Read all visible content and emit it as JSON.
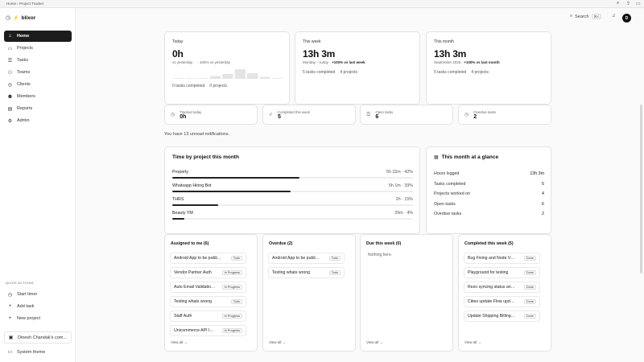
{
  "chrome": {
    "breadcrumb": "Home › Project Tracker"
  },
  "sidebar": {
    "brand": "blixor",
    "items": [
      {
        "label": "Home",
        "icon": "home-icon",
        "glyph": "⌂"
      },
      {
        "label": "Projects",
        "icon": "folder-icon",
        "glyph": "▭"
      },
      {
        "label": "Tasks",
        "icon": "checklist-icon",
        "glyph": "☰"
      },
      {
        "label": "Teams",
        "icon": "team-icon",
        "glyph": "⚇"
      },
      {
        "label": "Clients",
        "icon": "client-icon",
        "glyph": "◎"
      },
      {
        "label": "Members",
        "icon": "members-icon",
        "glyph": "⚉"
      },
      {
        "label": "Reports",
        "icon": "reports-icon",
        "glyph": "▤"
      },
      {
        "label": "Admin",
        "icon": "admin-icon",
        "glyph": "⚙"
      }
    ],
    "quick_actions_title": "QUICK ACTIONS",
    "quick_actions": [
      {
        "label": "Start timer",
        "glyph": "◷"
      },
      {
        "label": "Add task",
        "glyph": "+"
      },
      {
        "label": "New project",
        "glyph": "+"
      }
    ],
    "workspace": "Dinesh Chandak's com…",
    "theme": "System theme"
  },
  "topbar": {
    "search_label": "Search",
    "shortcut": "⌘K",
    "avatar_initial": "D"
  },
  "summary": {
    "today": {
      "kicker": "Today",
      "value": "0h",
      "vs_yesterday_label": "vs yesterday",
      "vs_pct": "- 100% vs yesterday",
      "tasks": "0 tasks completed",
      "projects": "0 projects",
      "sparkline": [
        0,
        0,
        0,
        0.3,
        0.5,
        1,
        0.6,
        0.2,
        0
      ]
    },
    "week": {
      "kicker": "This week",
      "value": "13h 3m",
      "range": "Monday – today",
      "change": "+100% vs last week",
      "tasks": "5 tasks completed",
      "projects": "4 projects"
    },
    "month": {
      "kicker": "This month",
      "value": "13h 3m",
      "range": "September 2026",
      "change": "+100% vs last month",
      "tasks": "5 tasks completed",
      "projects": "4 projects"
    }
  },
  "stats": [
    {
      "label": "Tracked today",
      "value": "0h",
      "icon": "clock-icon",
      "glyph": "◷"
    },
    {
      "label": "Completed this week",
      "value": "5",
      "icon": "check-circle-icon",
      "glyph": "✓"
    },
    {
      "label": "Open tasks",
      "value": "6",
      "icon": "list-icon",
      "glyph": "☰"
    },
    {
      "label": "Overdue tasks",
      "value": "2",
      "icon": "alert-circle-icon",
      "glyph": "◷"
    }
  ],
  "notice": "You have 13 unread notifications.",
  "time_by_project": {
    "title": "Time by project this month",
    "rows": [
      {
        "name": "Property",
        "detail": "5h 32m · 42%",
        "pct": 42
      },
      {
        "name": "Whatsapp Hiring Bot",
        "detail": "5h 1m · 39%",
        "pct": 39
      },
      {
        "name": "THRS",
        "detail": "2h · 15%",
        "pct": 15
      },
      {
        "name": "Beauty YM",
        "detail": "29m · 4%",
        "pct": 4
      }
    ]
  },
  "glance": {
    "title": "This month at a glance",
    "rows": [
      {
        "k": "Hours logged",
        "v": "13h 3m"
      },
      {
        "k": "Tasks completed",
        "v": "5"
      },
      {
        "k": "Projects worked on",
        "v": "4"
      },
      {
        "k": "Open tasks",
        "v": "6"
      },
      {
        "k": "Overdue tasks",
        "v": "2"
      }
    ]
  },
  "lists": [
    {
      "title": "Assigned to me (6)",
      "items": [
        {
          "t": "Android App to be publi…",
          "b": "Todo"
        },
        {
          "t": "Vendor Partner Auth",
          "b": "In Progress"
        },
        {
          "t": "Auto Email Validatio…",
          "b": "In Progress"
        },
        {
          "t": "Testing whats wrong",
          "b": "Todo"
        },
        {
          "t": "Staff Auth",
          "b": "In Progress"
        },
        {
          "t": "Unicommerce API I…",
          "b": "In Progress"
        }
      ],
      "view_all": "View all →"
    },
    {
      "title": "Overdue (2)",
      "items": [
        {
          "t": "Android App to be publi…",
          "b": "Todo"
        },
        {
          "t": "Testing whats wrong",
          "b": "Todo"
        }
      ],
      "view_all": "View all →"
    },
    {
      "title": "Due this week (0)",
      "empty": "Nothing here.",
      "items": [],
      "view_all": "View all →"
    },
    {
      "title": "Completed this week (5)",
      "items": [
        {
          "t": "Bug Fixing and Node Ve…",
          "b": "Done"
        },
        {
          "t": "Playground for testing",
          "b": "Done"
        },
        {
          "t": "Rezo syncing status an…",
          "b": "Done"
        },
        {
          "t": "Cities update Flow upd…",
          "b": "Done"
        },
        {
          "t": "Update Shipping Billing…",
          "b": "Done"
        }
      ],
      "view_all": "View all →"
    }
  ]
}
